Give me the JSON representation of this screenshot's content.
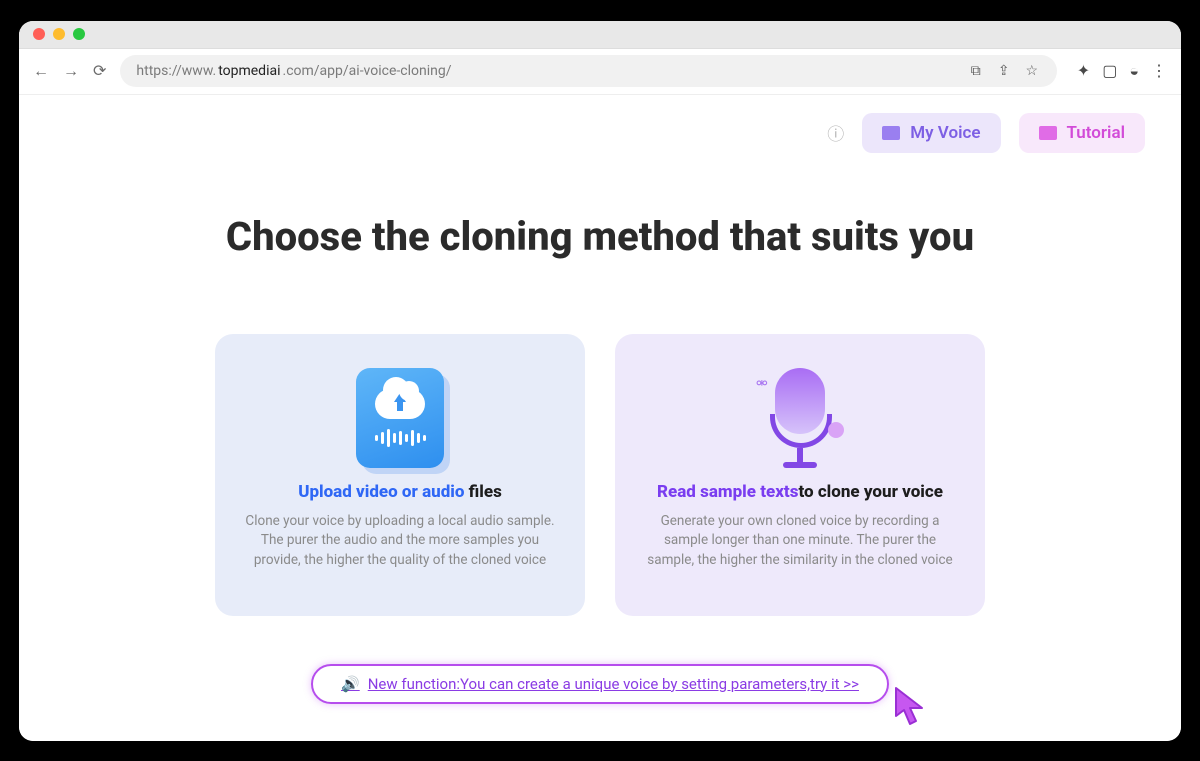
{
  "browser": {
    "url_prefix": "https://www.",
    "url_domain": "topmediai",
    "url_suffix": ".com/app/ai-voice-cloning/"
  },
  "header": {
    "my_voice": "My Voice",
    "tutorial": "Tutorial"
  },
  "headline": "Choose the cloning method that suits you",
  "cards": {
    "upload": {
      "title_accent": "Upload video or audio",
      "title_rest": " files",
      "desc": "Clone your voice by uploading a local audio sample. The purer the audio and the more samples you provide, the higher the quality of the cloned voice"
    },
    "record": {
      "title_accent": "Read sample texts",
      "title_rest": "to clone your voice",
      "desc": "Generate your own cloned voice by recording a sample longer than one minute. The purer the sample, the higher the similarity in the cloned voice"
    }
  },
  "banner": {
    "text": "New function:You can create a unique voice by setting parameters,try it >>"
  }
}
